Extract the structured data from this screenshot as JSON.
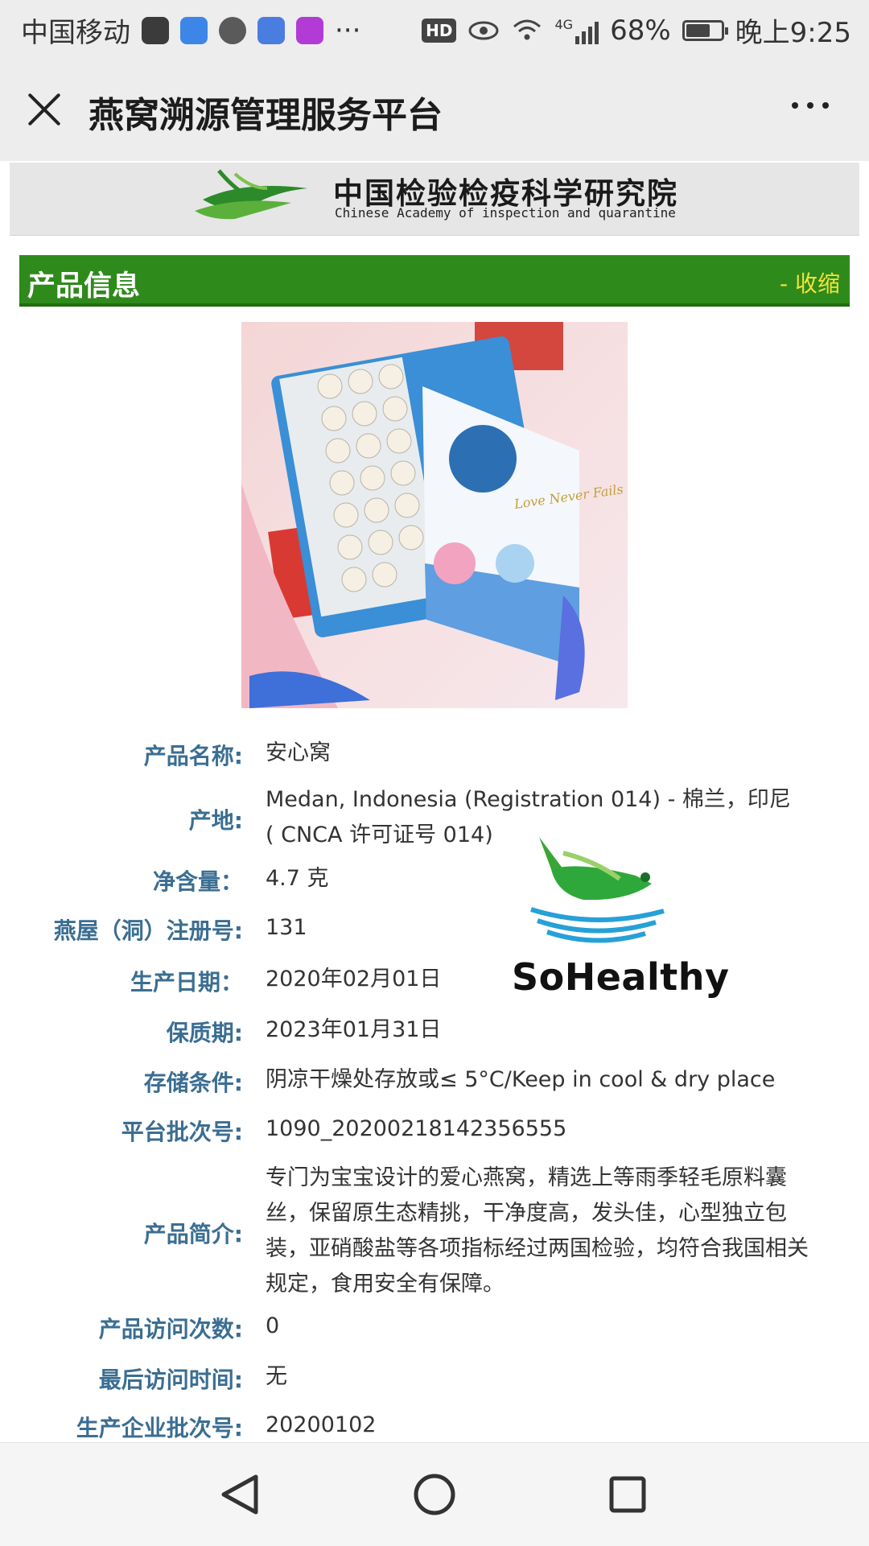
{
  "status_bar": {
    "carrier": "中国移动",
    "hd": "HD",
    "network": "4G",
    "battery": "68%",
    "battery_level": 0.68,
    "time": "晚上9:25",
    "more": "···"
  },
  "title_bar": {
    "title": "燕窝溯源管理服务平台"
  },
  "banner": {
    "name_cn": "中国检验检疫科学研究院",
    "name_en": "Chinese Academy of inspection and quarantine"
  },
  "section": {
    "title": "产品信息",
    "collapse_label": "- 收缩"
  },
  "product_image": {
    "box_text": "Love Never Fails"
  },
  "info_rows": [
    {
      "label": "产品名称:",
      "value": "安心窝"
    },
    {
      "label": "产地:",
      "value": "Medan, Indonesia (Registration 014) - 棉兰，印尼 ( CNCA 许可证号 014)"
    },
    {
      "label": "净含量：",
      "value": "4.7 克"
    },
    {
      "label": "燕屋（洞）注册号:",
      "value": "131"
    },
    {
      "label": "生产日期：",
      "value": "2020年02月01日"
    },
    {
      "label": "保质期:",
      "value": "2023年01月31日"
    },
    {
      "label": "存储条件:",
      "value": "阴凉干燥处存放或≤ 5°C/Keep in cool & dry place"
    },
    {
      "label": "平台批次号:",
      "value": "1090_20200218142356555"
    },
    {
      "label": "产品简介:",
      "value": "专门为宝宝设计的爱心燕窝，精选上等雨季轻毛原料囊丝，保留原生态精挑，干净度高，发头佳，心型独立包装，亚硝酸盐等各项指标经过两国检验，均符合我国相关规定，食用安全有保障。"
    },
    {
      "label": "产品访问次数:",
      "value": "0"
    },
    {
      "label": "最后访问时间:",
      "value": "无"
    },
    {
      "label": "生产企业批次号:",
      "value": "20200102"
    }
  ],
  "watermark": {
    "text": "SoHealthy"
  },
  "icons": {
    "close": "close-icon",
    "more": "more-icon",
    "back": "back-triangle-icon",
    "home": "home-circle-icon",
    "recents": "recents-square-icon"
  },
  "colors": {
    "section_green": "#2f8a1c",
    "collapse_yellow": "#f0e33a",
    "label_blue": "#3b6e92",
    "bar_gray": "#ededed"
  }
}
